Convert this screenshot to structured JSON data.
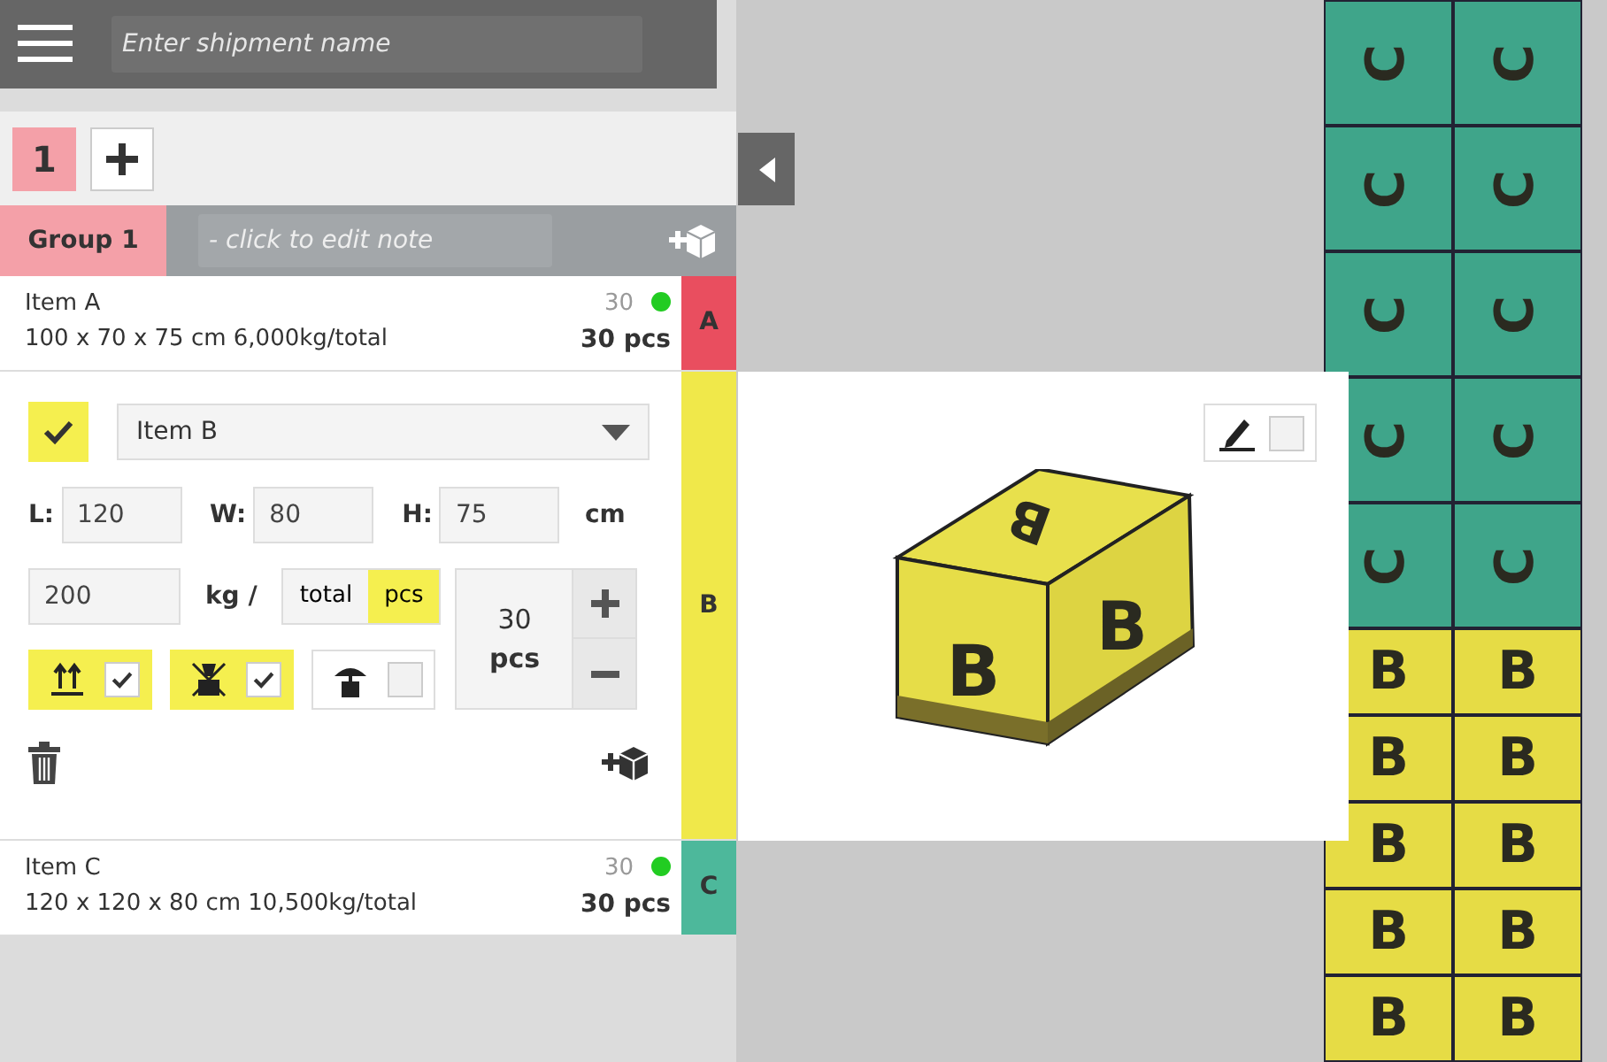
{
  "header": {
    "shipment_placeholder": "Enter shipment name"
  },
  "group_tabs": [
    {
      "label": "1",
      "selected": true
    }
  ],
  "group": {
    "name": "Group 1",
    "note_placeholder": "- click to edit note"
  },
  "items": [
    {
      "kind": "collapsed",
      "name": "Item A",
      "details": "100 x 70 x 75 cm 6,000kg/total",
      "loaded": "30",
      "count": "30",
      "unit": "pcs",
      "complete": true,
      "tag": "A",
      "color": "#e94e5f"
    },
    {
      "kind": "expanded",
      "tag": "B",
      "color": "#f0e84a",
      "checked": true,
      "name": "Item B",
      "dims": [
        {
          "label": "L:",
          "value": "120"
        },
        {
          "label": "W:",
          "value": "80"
        },
        {
          "label": "H:",
          "value": "75"
        }
      ],
      "dim_unit": "cm",
      "weight": "200",
      "weight_unit": "kg /",
      "weight_modes": [
        {
          "label": "total",
          "selected": false
        },
        {
          "label": "pcs",
          "selected": true
        }
      ],
      "quantity": "30",
      "quantity_unit": "pcs",
      "flags": [
        {
          "kind": "this-side-up",
          "checked": true
        },
        {
          "kind": "no-stack",
          "checked": true
        },
        {
          "kind": "fragile",
          "checked": false
        }
      ]
    },
    {
      "kind": "collapsed",
      "name": "Item C",
      "details": "120 x 120 x 80 cm 10,500kg/total",
      "loaded": "30",
      "count": "30",
      "unit": "pcs",
      "complete": true,
      "tag": "C",
      "color": "#4db89b"
    }
  ],
  "preview": {
    "labels": [
      "B",
      "B",
      "B"
    ],
    "edit_checked": false
  },
  "load_view": {
    "boxes": [
      {
        "label": "C",
        "color": "#3fa58a",
        "rotated": true
      },
      {
        "label": "C",
        "color": "#3fa58a",
        "rotated": true
      },
      {
        "label": "C",
        "color": "#3fa58a",
        "rotated": true
      },
      {
        "label": "C",
        "color": "#3fa58a",
        "rotated": true
      },
      {
        "label": "C",
        "color": "#3fa58a",
        "rotated": true
      },
      {
        "label": "C",
        "color": "#3fa58a",
        "rotated": true
      },
      {
        "label": "C",
        "color": "#3fa58a",
        "rotated": true
      },
      {
        "label": "C",
        "color": "#3fa58a",
        "rotated": true
      },
      {
        "label": "C",
        "color": "#3fa58a",
        "rotated": true
      },
      {
        "label": "C",
        "color": "#3fa58a",
        "rotated": true
      },
      {
        "label": "B",
        "color": "#e6dc45",
        "rotated": false
      },
      {
        "label": "B",
        "color": "#e6dc45",
        "rotated": false
      },
      {
        "label": "B",
        "color": "#e6dc45",
        "rotated": false
      },
      {
        "label": "B",
        "color": "#e6dc45",
        "rotated": false
      },
      {
        "label": "B",
        "color": "#e6dc45",
        "rotated": false
      },
      {
        "label": "B",
        "color": "#e6dc45",
        "rotated": false
      },
      {
        "label": "B",
        "color": "#e6dc45",
        "rotated": false
      },
      {
        "label": "B",
        "color": "#e6dc45",
        "rotated": false
      },
      {
        "label": "B",
        "color": "#e6dc45",
        "rotated": false
      },
      {
        "label": "B",
        "color": "#e6dc45",
        "rotated": false
      }
    ]
  }
}
